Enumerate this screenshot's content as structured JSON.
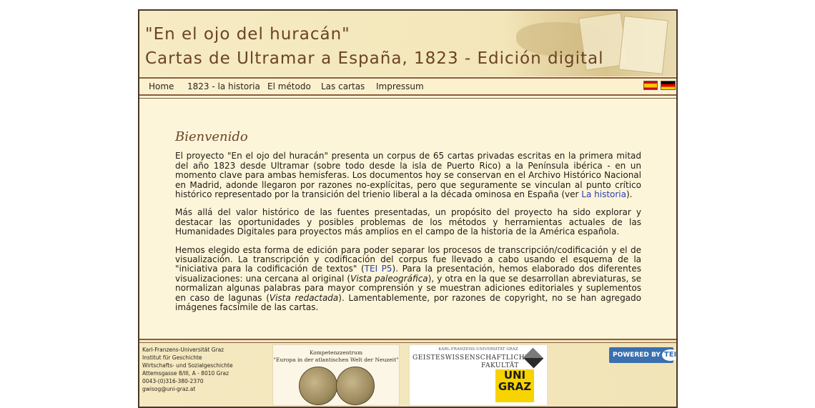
{
  "header": {
    "title_line1": "\"En el ojo del huracán\"",
    "title_line2": "Cartas de Ultramar a España, 1823 - Edición digital"
  },
  "nav": {
    "items": [
      "Home",
      "1823 - la historia",
      "El método",
      "Las cartas",
      "Impressum"
    ],
    "flags": [
      "flag-spain-icon",
      "flag-germany-icon"
    ]
  },
  "content": {
    "heading": "Bienvenido",
    "p1_a": "El proyecto \"En el ojo del huracán\" presenta un corpus de 65 cartas privadas escritas en la primera mitad del año 1823 desde Ultramar (sobre todo desde la isla de Puerto Rico) a la Península ibérica - en un momento clave para ambas hemisferas. Los documentos hoy se conservan en el Archivo Histórico Nacional en Madrid, adonde llegaron por razones no-explícitas, pero que seguramente se vinculan al punto crítico histórico representado por la transición del trienio liberal a la década ominosa en España (ver ",
    "p1_link": "La historia",
    "p1_b": ").",
    "p2": "Más allá del valor histórico de las fuentes presentadas, un propósito del proyecto ha sido explorar y destacar las oportunidades y posibles problemas de los métodos y herramientas actuales de las Humanidades Digitales para proyectos más amplios en el campo de la historia de la América española.",
    "p3_a": "Hemos elegido esta forma de edición para poder separar los procesos de transcripción/codificación y el de visualización. La transcripción y codificación del corpus fue llevado a cabo usando el esquema de la \"iniciativa para la codificación de textos\" (",
    "p3_link": "TEI P5",
    "p3_b": "). Para la presentación, hemos elaborado dos diferentes visualizaciones: una cercana al original (",
    "p3_em1": "Vista paleográfica",
    "p3_c": "), y otra en la que se desarrollan abreviaturas, se normalizan algunas palabras para mayor comprensión y se muestran adiciones editoriales y suplementos en caso de lagunas (",
    "p3_em2": "Vista redactada",
    "p3_d": "). Lamentablemente, por razones de copyright, no se han agregado imágenes facsímile de las cartas."
  },
  "footer": {
    "address": [
      "Karl-Franzens-Universität Graz",
      "Institut für Geschichte",
      "Wirtschafts- und Sozialgeschichte",
      "Attemsgasse 8/III, A - 8010 Graz",
      "0043-(0)316-380-2370",
      "gwisog@uni-graz.at"
    ],
    "kompetenz_line1": "Kompetenzzentrum",
    "kompetenz_line2": "\"Europa in der atlantischen Welt der Neuzeit\"",
    "geist_line1": "KARL-FRANZENS-UNIVERSITÄT GRAZ",
    "geist_line2": "GEISTESWISSENSCHAFTLICHE",
    "geist_line3": "FAKULTÄT",
    "uni_line1": "UNI",
    "uni_line2": "GRAZ",
    "tei_label": "POWERED BY",
    "tei_mark": "TEI"
  }
}
